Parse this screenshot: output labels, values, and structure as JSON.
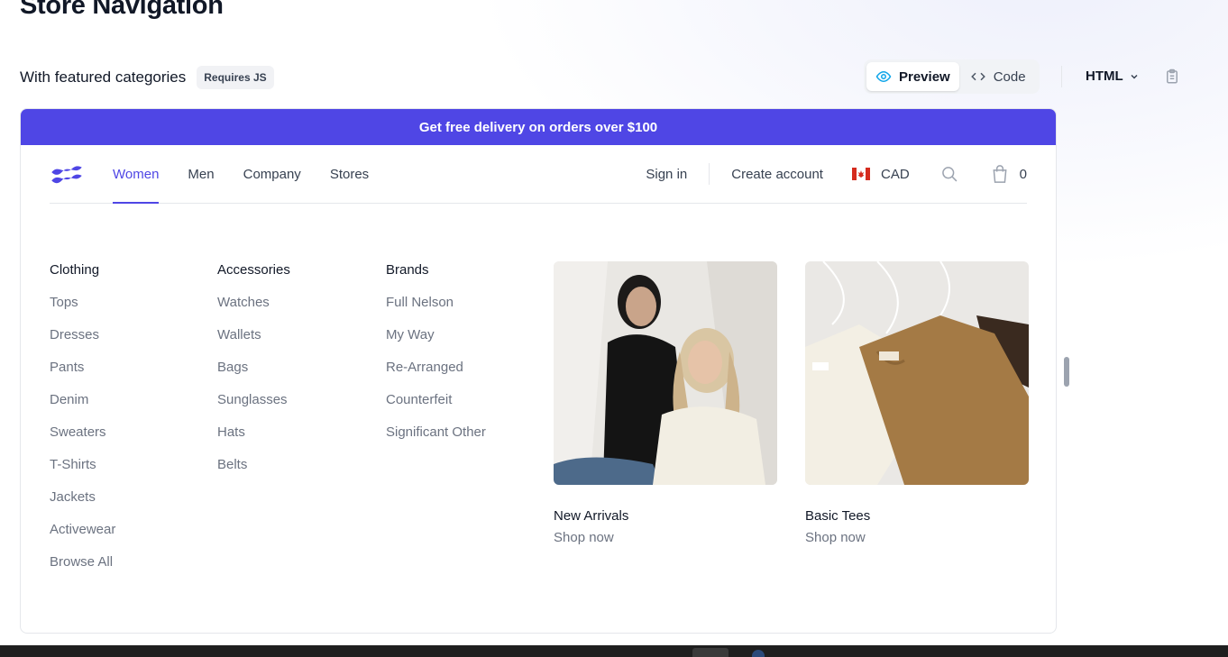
{
  "header": {
    "title": "Store Navigation",
    "subtitle": "With featured categories",
    "badge": "Requires JS",
    "preview_label": "Preview",
    "code_label": "Code",
    "language": "HTML"
  },
  "store": {
    "banner": "Get free delivery on orders over $100",
    "nav": {
      "tabs": [
        "Women",
        "Men",
        "Company",
        "Stores"
      ],
      "active_tab": "Women",
      "sign_in": "Sign in",
      "create_account": "Create account",
      "currency": "CAD",
      "cart_count": "0"
    },
    "columns": [
      {
        "title": "Clothing",
        "items": [
          "Tops",
          "Dresses",
          "Pants",
          "Denim",
          "Sweaters",
          "T-Shirts",
          "Jackets",
          "Activewear",
          "Browse All"
        ]
      },
      {
        "title": "Accessories",
        "items": [
          "Watches",
          "Wallets",
          "Bags",
          "Sunglasses",
          "Hats",
          "Belts"
        ]
      },
      {
        "title": "Brands",
        "items": [
          "Full Nelson",
          "My Way",
          "Re-Arranged",
          "Counterfeit",
          "Significant Other"
        ]
      }
    ],
    "featured": [
      {
        "name": "New Arrivals",
        "cta": "Shop now"
      },
      {
        "name": "Basic Tees",
        "cta": "Shop now"
      }
    ]
  },
  "colors": {
    "accent": "#4f46e5",
    "text_primary": "#111827",
    "text_muted": "#6b7280"
  }
}
